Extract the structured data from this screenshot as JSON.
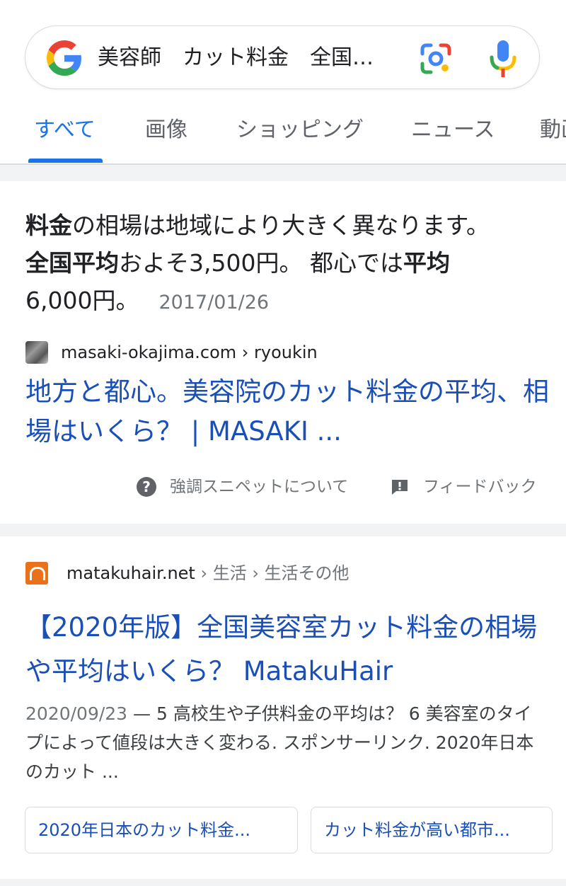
{
  "search": {
    "query": "美容師　カット料金　全国…",
    "lens_icon": "google-lens-icon",
    "mic_icon": "microphone-icon"
  },
  "tabs": [
    {
      "label": "すべて",
      "active": true
    },
    {
      "label": "画像"
    },
    {
      "label": "ショッピング"
    },
    {
      "label": "ニュース"
    },
    {
      "label": "動画"
    }
  ],
  "featured": {
    "snippet": {
      "l1_b1": "料金",
      "l1_t1": "の相場は地域により大きく異なります。",
      "l2_b1": "全国平均",
      "l2_t1": "およそ3,500円。 都心では",
      "l2_b2": "平均",
      "l3_t1": "6,000円。",
      "date": "2017/01/26"
    },
    "source": "masaki-okajima.com › ryoukin",
    "title": "地方と都心。美容院のカット料金の平均、相場はいくら？ | MASAKI ...",
    "about_label": "強調スニペットについて",
    "feedback_label": "フィードバック"
  },
  "result2": {
    "domain": "matakuhair.net",
    "breadcrumb": " › 生活 › 生活その他",
    "title": "【2020年版】全国美容室カット料金の相場や平均はいくら？ MatakuHair",
    "date": "2020/09/23",
    "snippet": " — 5 高校生や子供料金の平均は？ 6 美容室のタイプによって値段は大きく変わる. スポンサーリンク. 2020年日本のカット ...",
    "chips": [
      "2020年日本のカット料金...",
      "カット料金が高い都市..."
    ]
  },
  "colors": {
    "link": "#1a4fb8",
    "active_tab": "#1a73e8",
    "separator": "#f1f3f4"
  }
}
